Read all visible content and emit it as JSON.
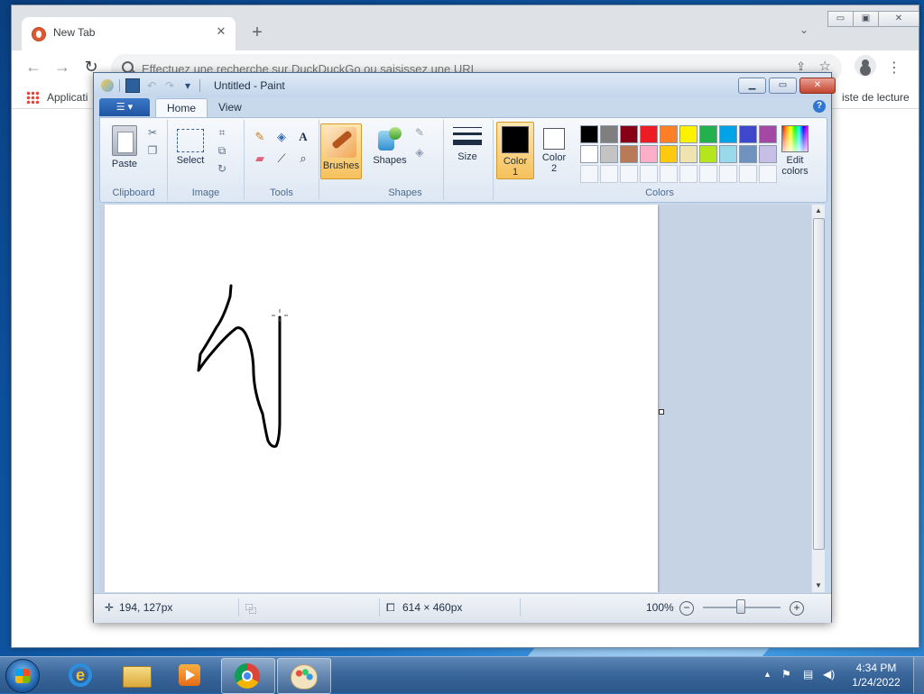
{
  "browser": {
    "tab_title": "New Tab",
    "tab_close": "✕",
    "new_tab": "+",
    "tab_search": "⌄",
    "omnibox_placeholder": "Effectuez une recherche sur DuckDuckGo ou saisissez une URL",
    "bookmarks": {
      "apps_label": "Applicati",
      "reading_list": "iste de lecture"
    },
    "nav": {
      "back": "←",
      "forward": "→",
      "reload": "↻",
      "menu": "⋮",
      "share": "⇪",
      "star": "☆"
    },
    "window_controls": {
      "minimize": "▭",
      "maximize": "▣",
      "close": "✕"
    }
  },
  "paint": {
    "title": "Untitled - Paint",
    "window_controls": {
      "minimize": "▁",
      "maximize": "▭",
      "close": "✕"
    },
    "qat": {
      "undo": "↶",
      "redo": "↷",
      "customize": "▾"
    },
    "file_button": "☰ ▾",
    "tabs": [
      {
        "label": "Home",
        "active": true
      },
      {
        "label": "View",
        "active": false
      }
    ],
    "help": "?",
    "ribbon": {
      "groups": {
        "clipboard": "Clipboard",
        "image": "Image",
        "tools": "Tools",
        "shapes": "Shapes",
        "colors": "Colors"
      },
      "paste_label": "Paste",
      "select_label": "Select",
      "brushes_label": "Brushes",
      "shapes_label": "Shapes",
      "size_label": "Size",
      "color1_label": "Color 1",
      "color1_num": "1",
      "color2_label": "Color",
      "color2_num": "2",
      "edit_colors_label": "Edit colors",
      "tool_icons": {
        "pencil": "✎",
        "fill": "◈",
        "text": "A",
        "eraser": "▰",
        "picker": "⟋",
        "magnifier": "⌕"
      },
      "small_icons": {
        "cut": "✂",
        "copy": "❐",
        "crop": "⌗",
        "resize": "⧉",
        "rotate": "↻"
      },
      "color1": "#000000",
      "color2": "#ffffff",
      "palette_row1": [
        "#000000",
        "#7f7f7f",
        "#880015",
        "#ed1c24",
        "#ff7f27",
        "#fff200",
        "#22b14c",
        "#00a2e8",
        "#3f48cc",
        "#a349a4"
      ],
      "palette_row2": [
        "#ffffff",
        "#c3c3c3",
        "#b97a57",
        "#ffaec9",
        "#ffc90e",
        "#efe4b0",
        "#b5e61d",
        "#99d9ea",
        "#7092be",
        "#c8bfe7"
      ]
    },
    "status": {
      "cursor_pos": "194, 127px",
      "canvas_size": "614 × 460px",
      "zoom": "100%",
      "zoom_out": "−",
      "zoom_in": "+"
    }
  },
  "taskbar": {
    "clock_time": "4:34 PM",
    "clock_date": "1/24/2022",
    "tray": {
      "up_arrow": "▲",
      "flag": "⚑",
      "network": "▤",
      "volume": "◀)"
    }
  }
}
